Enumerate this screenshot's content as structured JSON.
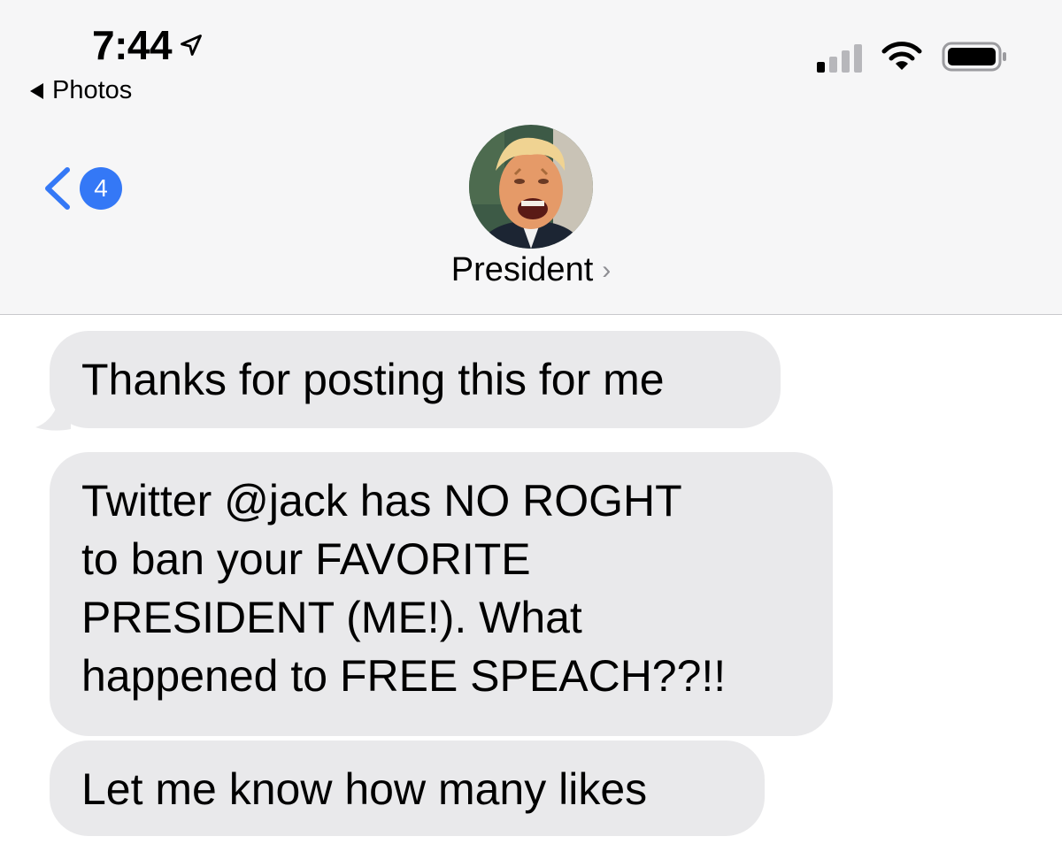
{
  "status_bar": {
    "time": "7:44",
    "back_app": "Photos",
    "icons": [
      "location-arrow-icon",
      "cellular-signal-icon",
      "wifi-icon",
      "battery-icon"
    ]
  },
  "nav": {
    "unread_count": "4",
    "contact_name": "President",
    "chevron": "›",
    "avatar_icon": "contact-avatar"
  },
  "colors": {
    "accent": "#3478f6",
    "bubble": "#e9e9eb",
    "header_bg": "#f6f6f7"
  },
  "messages": [
    {
      "text": "Thanks for posting this for me"
    },
    {
      "lines": [
        "Twitter @jack has NO ROGHT",
        "to ban your FAVORITE",
        "PRESIDENT (ME!). What",
        "happened to FREE SPEACH??!!"
      ]
    },
    {
      "text": "Let me know how many likes"
    }
  ]
}
